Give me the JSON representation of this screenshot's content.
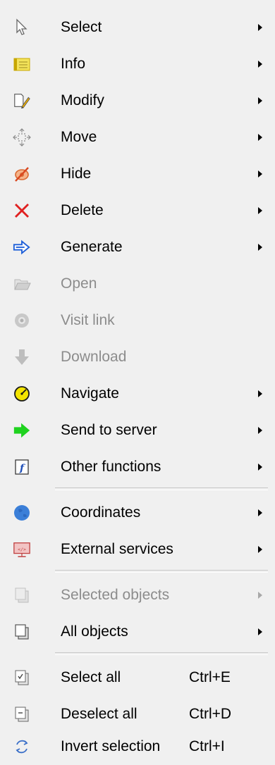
{
  "menu": {
    "items": [
      {
        "label": "Select",
        "icon": "cursor-icon",
        "submenu": true,
        "enabled": true
      },
      {
        "label": "Info",
        "icon": "info-card-icon",
        "submenu": true,
        "enabled": true
      },
      {
        "label": "Modify",
        "icon": "edit-pencil-icon",
        "submenu": true,
        "enabled": true
      },
      {
        "label": "Move",
        "icon": "move-icon",
        "submenu": true,
        "enabled": true
      },
      {
        "label": "Hide",
        "icon": "hide-eye-icon",
        "submenu": true,
        "enabled": true
      },
      {
        "label": "Delete",
        "icon": "delete-x-icon",
        "submenu": true,
        "enabled": true
      },
      {
        "label": "Generate",
        "icon": "generate-arrow-icon",
        "submenu": true,
        "enabled": true
      },
      {
        "label": "Open",
        "icon": "open-folder-icon",
        "submenu": false,
        "enabled": false
      },
      {
        "label": "Visit link",
        "icon": "link-globe-icon",
        "submenu": false,
        "enabled": false
      },
      {
        "label": "Download",
        "icon": "download-arrow-icon",
        "submenu": false,
        "enabled": false
      },
      {
        "label": "Navigate",
        "icon": "navigate-compass-icon",
        "submenu": true,
        "enabled": true
      },
      {
        "label": "Send to server",
        "icon": "send-arrow-icon",
        "submenu": true,
        "enabled": true
      },
      {
        "label": "Other functions",
        "icon": "function-icon",
        "submenu": true,
        "enabled": true
      },
      {
        "label": "Coordinates",
        "icon": "globe-icon",
        "submenu": true,
        "enabled": true
      },
      {
        "label": "External services",
        "icon": "external-services-icon",
        "submenu": true,
        "enabled": true
      },
      {
        "label": "Selected objects",
        "icon": "selected-objects-icon",
        "submenu": true,
        "enabled": false
      },
      {
        "label": "All objects",
        "icon": "all-objects-icon",
        "submenu": true,
        "enabled": true
      },
      {
        "label": "Select all",
        "icon": "select-all-icon",
        "shortcut": "Ctrl+E",
        "enabled": true
      },
      {
        "label": "Deselect all",
        "icon": "deselect-all-icon",
        "shortcut": "Ctrl+D",
        "enabled": true
      },
      {
        "label": "Invert selection",
        "icon": "invert-selection-icon",
        "shortcut": "Ctrl+I",
        "enabled": true
      }
    ]
  },
  "colors": {
    "delete_red": "#e02020",
    "generate_blue": "#1e5fd8",
    "send_green": "#1fd21f",
    "navigate_yellow": "#f3e400",
    "globe_blue": "#3b7fd8",
    "disabled_gray": "#8c8c8c"
  }
}
